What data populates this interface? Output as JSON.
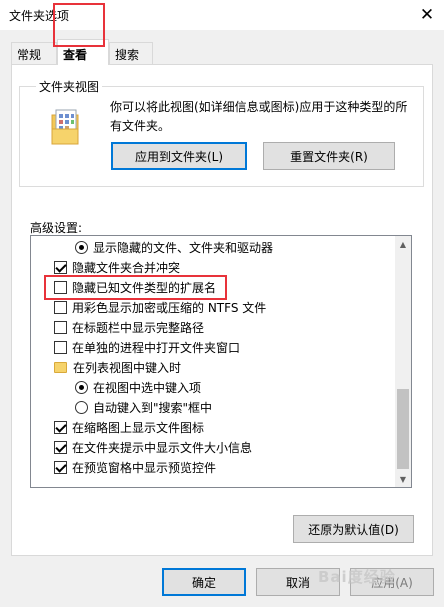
{
  "window": {
    "title": "文件夹选项"
  },
  "tabs": [
    {
      "label": "常规"
    },
    {
      "label": "查看"
    },
    {
      "label": "搜索"
    }
  ],
  "folder_views": {
    "group_title": "文件夹视图",
    "description": "你可以将此视图(如详细信息或图标)应用于这种类型的所有文件夹。",
    "apply_button": "应用到文件夹(L)",
    "reset_button": "重置文件夹(R)"
  },
  "advanced": {
    "label": "高级设置:",
    "items": [
      {
        "type": "radio",
        "checked": true,
        "label": "显示隐藏的文件、文件夹和驱动器"
      },
      {
        "type": "checkbox",
        "checked": true,
        "label": "隐藏文件夹合并冲突"
      },
      {
        "type": "checkbox",
        "checked": false,
        "label": "隐藏已知文件类型的扩展名"
      },
      {
        "type": "checkbox",
        "checked": false,
        "label": "用彩色显示加密或压缩的 NTFS 文件"
      },
      {
        "type": "checkbox",
        "checked": false,
        "label": "在标题栏中显示完整路径"
      },
      {
        "type": "checkbox",
        "checked": false,
        "label": "在单独的进程中打开文件夹窗口"
      },
      {
        "type": "folder",
        "label": "在列表视图中键入时"
      },
      {
        "type": "radio",
        "checked": true,
        "label": "在视图中选中键入项"
      },
      {
        "type": "radio",
        "checked": false,
        "label": "自动键入到\"搜索\"框中"
      },
      {
        "type": "checkbox",
        "checked": true,
        "label": "在缩略图上显示文件图标"
      },
      {
        "type": "checkbox",
        "checked": true,
        "label": "在文件夹提示中显示文件大小信息"
      },
      {
        "type": "checkbox",
        "checked": true,
        "label": "在预览窗格中显示预览控件"
      }
    ]
  },
  "buttons": {
    "restore": "还原为默认值(D)",
    "ok": "确定",
    "cancel": "取消",
    "apply": "应用(A)"
  },
  "watermark": "Bai度经验",
  "colors": {
    "highlight": "#e8323a",
    "accent": "#0078d7"
  }
}
